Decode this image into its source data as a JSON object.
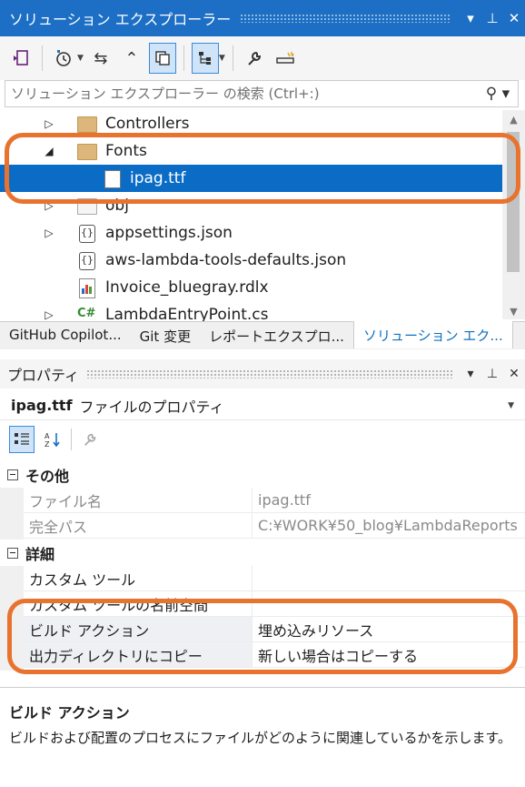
{
  "explorer": {
    "title": "ソリューション エクスプローラー",
    "title_buttons": [
      "▾",
      "⊥",
      "✕"
    ],
    "search_placeholder": "ソリューション エクスプローラー の検索 (Ctrl+:)",
    "tree": [
      {
        "label": "Controllers",
        "icon": "folder-icon",
        "arrow": "▷"
      },
      {
        "label": "Fonts",
        "icon": "folder-icon",
        "arrow": "◢"
      },
      {
        "label": "ipag.ttf",
        "icon": "font-file-icon",
        "arrow": ""
      },
      {
        "label": "obj",
        "icon": "folder-icon",
        "arrow": "▷"
      },
      {
        "label": "appsettings.json",
        "icon": "json-file-icon",
        "arrow": "▷"
      },
      {
        "label": "aws-lambda-tools-defaults.json",
        "icon": "json-file-icon",
        "arrow": ""
      },
      {
        "label": "Invoice_bluegray.rdlx",
        "icon": "report-file-icon",
        "arrow": ""
      },
      {
        "label": "LambdaEntryPoint.cs",
        "icon": "csharp-file-icon",
        "arrow": "▷"
      }
    ],
    "tabs": [
      {
        "label": "GitHub Copilot..."
      },
      {
        "label": "Git 変更"
      },
      {
        "label": "レポートエクスプロ..."
      },
      {
        "label": "ソリューション エク..."
      }
    ]
  },
  "properties": {
    "title": "プロパティ",
    "object_name": "ipag.ttf",
    "object_desc": "ファイルのプロパティ",
    "categories": [
      {
        "name": "その他",
        "rows": [
          {
            "name": "ファイル名",
            "value": "ipag.ttf"
          },
          {
            "name": "完全パス",
            "value": "C:¥WORK¥50_blog¥LambdaReports"
          }
        ]
      },
      {
        "name": "詳細",
        "rows": [
          {
            "name": "カスタム ツール",
            "value": ""
          },
          {
            "name": "カスタム ツールの名前空間",
            "value": ""
          },
          {
            "name": "ビルド アクション",
            "value": "埋め込みリソース"
          },
          {
            "name": "出力ディレクトリにコピー",
            "value": "新しい場合はコピーする"
          }
        ]
      }
    ],
    "description": {
      "title": "ビルド アクション",
      "text": "ビルドおよび配置のプロセスにファイルがどのように関連しているかを示します。"
    }
  },
  "colors": {
    "titlebar": "#1c6fc4",
    "selection": "#0b6cc6",
    "callout": "#e8732e"
  }
}
